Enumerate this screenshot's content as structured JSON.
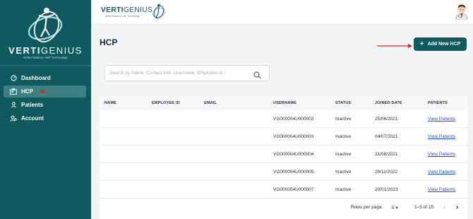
{
  "app": {
    "logo_text_bold": "VERTI",
    "logo_text_thin": "GENIUS",
    "logo_tagline": "Better Balance with Technology"
  },
  "header": {
    "brand_bold": "VERTI",
    "brand_thin": "GENIUS",
    "brand_tagline": "Better Balance with Technology"
  },
  "sidebar": {
    "items": [
      {
        "label": "Dashboard",
        "icon": "dashboard-icon"
      },
      {
        "label": "HCP",
        "icon": "hcp-icon",
        "active": true
      },
      {
        "label": "Patients",
        "icon": "person-icon"
      },
      {
        "label": "Account",
        "icon": "account-icon"
      }
    ]
  },
  "main": {
    "title": "HCP",
    "add_button_label": "Add New HCP",
    "search_placeholder": "Search by Name, Contact Info, Username, Employee Id"
  },
  "table": {
    "columns": [
      "NAME",
      "EMPLOYEE ID",
      "EMAIL",
      "USERNAME",
      "STATUS",
      "JOINED DATE",
      "PATIENTS"
    ],
    "rows": [
      {
        "name": "",
        "employee_id": "",
        "email": "",
        "username": "VG000004U000002",
        "status": "Inactive",
        "joined": "25/06/2021",
        "patients": "View Patients"
      },
      {
        "name": "",
        "employee_id": "",
        "email": "",
        "username": "VG000004U000003",
        "status": "Inactive",
        "joined": "04/07/2021",
        "patients": "View Patients"
      },
      {
        "name": "",
        "employee_id": "",
        "email": "",
        "username": "VG000004U000004",
        "status": "Inactive",
        "joined": "31/08/2021",
        "patients": "View Patients"
      },
      {
        "name": "",
        "employee_id": "",
        "email": "",
        "username": "VG000004U000005",
        "status": "Inactive",
        "joined": "29/11/2022",
        "patients": "View Patients"
      },
      {
        "name": "",
        "employee_id": "",
        "email": "",
        "username": "VG000004U000007",
        "status": "Inactive",
        "joined": "20/01/2023",
        "patients": "View Patients"
      }
    ]
  },
  "pagination": {
    "rows_per_page_label": "Rows per page:",
    "rows_per_page_value": "5",
    "range": "1–5 of 15"
  },
  "colors": {
    "sidebar_bg": "#0e5a5f",
    "accent": "#0e5a5f",
    "link": "#1d4ed8",
    "annotation_red": "#e2231a"
  }
}
